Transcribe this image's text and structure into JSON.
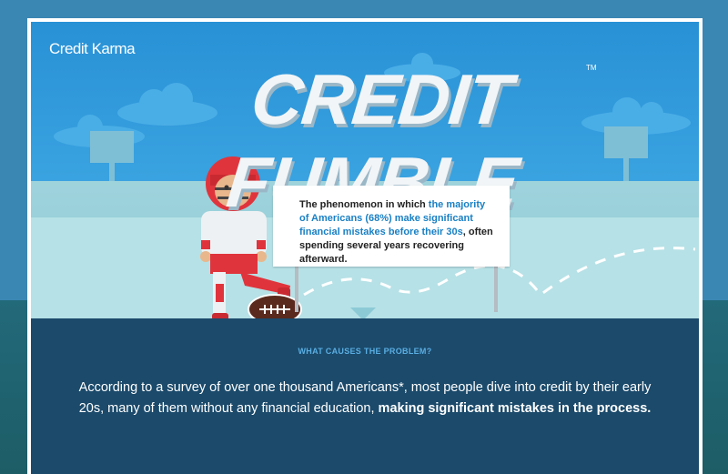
{
  "brand": {
    "logo_text": "Credit Karma"
  },
  "header": {
    "title": "CREDIT FUMBLE",
    "trademark": "TM"
  },
  "callout": {
    "part1": "The phenomenon in which ",
    "highlight": "the majority of Americans (68%) make significant financial mistakes before their 30s",
    "part2": ", often spending several years recovering afterward."
  },
  "section": {
    "subheading": "WHAT CAUSES THE PROBLEM?",
    "body_normal": "According to a survey of over one thousand Americans*, most people dive into credit by their early 20s, many of them without any financial education, ",
    "body_bold": "making significant mistakes in the process."
  },
  "colors": {
    "sky": "#2891d6",
    "bottom_panel": "#1b4a6b",
    "highlight_blue": "#1a80c4",
    "subheading_blue": "#5aaee3",
    "jersey_red": "#e0343c"
  },
  "icons": [
    "football-player-icon",
    "football-icon",
    "cloud-icon",
    "stadium-light-icon"
  ]
}
